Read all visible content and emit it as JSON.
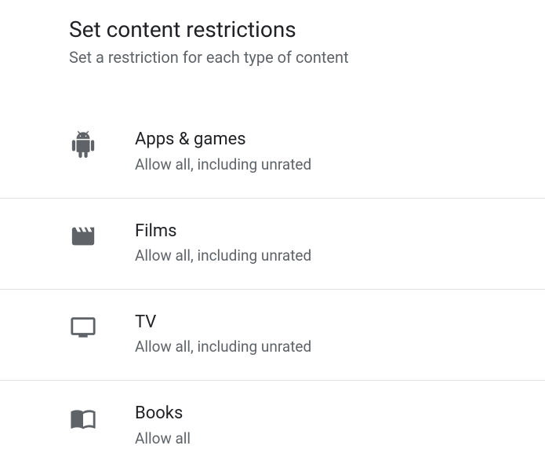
{
  "header": {
    "title": "Set content restrictions",
    "subtitle": "Set a restriction for each type of content"
  },
  "items": [
    {
      "title": "Apps & games",
      "subtitle": "Allow all, including unrated"
    },
    {
      "title": "Films",
      "subtitle": "Allow all, including unrated"
    },
    {
      "title": "TV",
      "subtitle": "Allow all, including unrated"
    },
    {
      "title": "Books",
      "subtitle": "Allow all"
    }
  ]
}
